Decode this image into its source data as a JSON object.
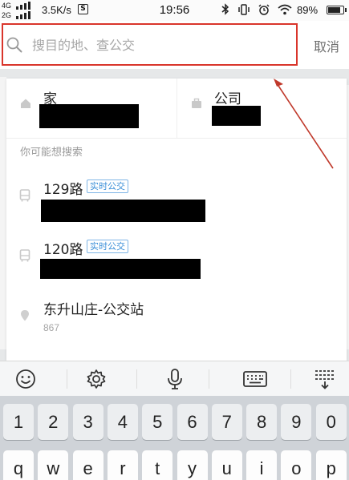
{
  "status_bar": {
    "network_top": "4G",
    "network_bottom": "2G",
    "speed": "3.5K/s",
    "notification_badge": "S",
    "time": "19:56",
    "icons": [
      "bluetooth-icon",
      "vibrate-icon",
      "alarm-icon",
      "wifi-icon"
    ],
    "battery_percent": "89%",
    "battery_level": 0.89
  },
  "search": {
    "placeholder": "搜目的地、查公交",
    "cancel_label": "取消"
  },
  "shortcuts": {
    "home_label": "家",
    "company_label": "公司"
  },
  "suggestions": {
    "section_title": "你可能想搜索",
    "items": [
      {
        "title": "129路",
        "tag": "实时公交",
        "icon": "bus-icon"
      },
      {
        "title": "120路",
        "tag": "实时公交",
        "icon": "bus-icon"
      },
      {
        "title": "东升山庄-公交站",
        "subtitle": "867",
        "icon": "location-pin-icon"
      }
    ]
  },
  "keyboard": {
    "toolbar_icons": [
      "emoji-icon",
      "settings-gear-icon",
      "microphone-icon",
      "keyboard-icon",
      "collapse-keyboard-icon"
    ],
    "number_row": [
      "1",
      "2",
      "3",
      "4",
      "5",
      "6",
      "7",
      "8",
      "9",
      "0"
    ],
    "letter_row": [
      "q",
      "w",
      "e",
      "r",
      "t",
      "y",
      "u",
      "i",
      "o",
      "p"
    ]
  },
  "colors": {
    "highlight_red": "#d9352b",
    "tag_blue": "#3b8fd8"
  }
}
